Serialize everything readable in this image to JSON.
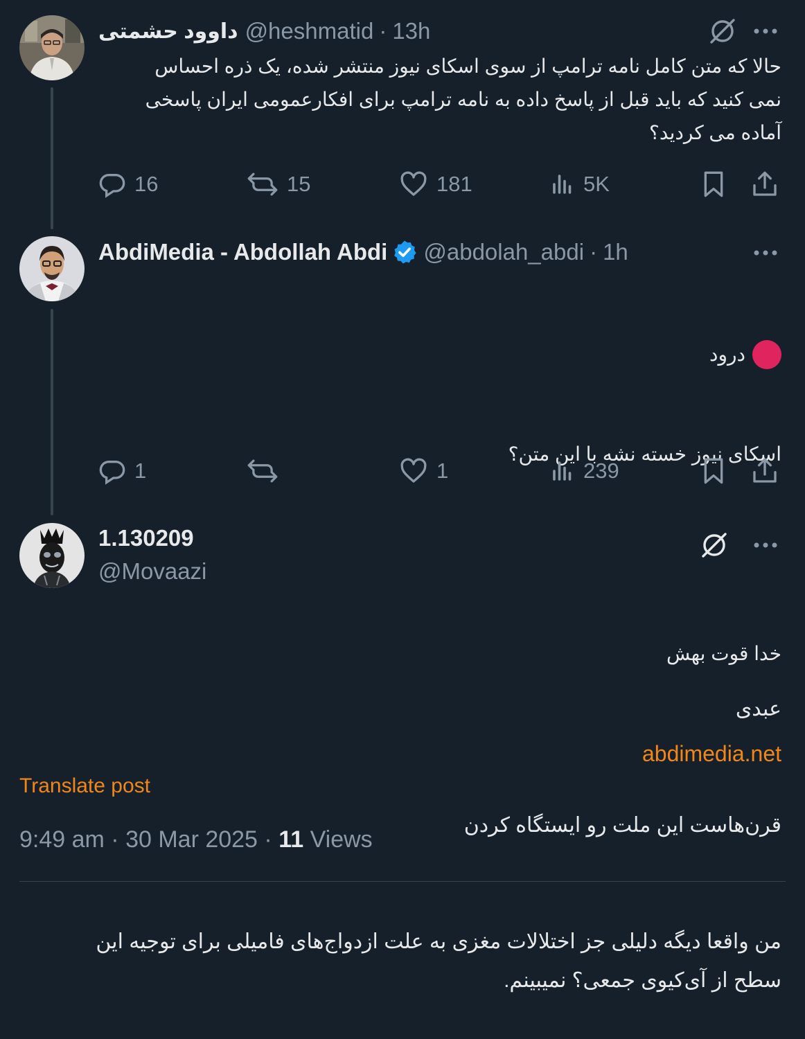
{
  "tweets": [
    {
      "display_name": "داوود حشمتی",
      "handle": "@heshmatid",
      "separator": "·",
      "time": "13h",
      "text": "حالا که متن کامل نامه ترامپ از سوی اسکای نیوز منتشر شده، یک ذره احساس نمی کنید که باید قبل از پاسخ داده به نامه ترامپ برای افکارعمومی ایران پاسخی آماده می کردید؟",
      "stats": {
        "replies": "16",
        "reposts": "15",
        "likes": "181",
        "views": "5K"
      }
    },
    {
      "display_name": "AbdiMedia - Abdollah Abdi",
      "handle": "@abdolah_abdi",
      "separator": "·",
      "time": "1h",
      "text_lines": [
        "درود",
        "اسکای نیوز خسته نشه با این متن؟",
        "",
        "خدا قوت بهش"
      ],
      "link": "abdimedia.net",
      "stats": {
        "replies": "1",
        "reposts": "",
        "likes": "1",
        "views": "239"
      }
    }
  ],
  "main_tweet": {
    "display_name": "1.130209",
    "handle": "@Movaazi",
    "text_lines": [
      "عبدی",
      "قرن‌هاست این ملت رو ایستگاه کردن",
      "من واقعا دیگه دلیلی جز اختلالات مغزی به علت ازدواج‌های فامیلی برای توجیه این سطح از آی‌کیوی جمعی؟ نمیبینم."
    ],
    "translate_label": "Translate post",
    "timestamp": "9:49 am · 30 Mar 2025 · ",
    "views_count": "11",
    "views_label": " Views"
  },
  "colors": {
    "background": "#15202b",
    "text": "#e7e9ea",
    "secondary": "#8b98a5",
    "accent": "#f18619",
    "verified": "#1d9bf0",
    "red_circle": "#e0245e"
  },
  "icons": [
    "grok-icon",
    "more-icon",
    "reply-icon",
    "repost-icon",
    "like-icon",
    "views-icon",
    "bookmark-icon",
    "share-icon",
    "verified-badge-icon",
    "red-circle-emoji"
  ]
}
